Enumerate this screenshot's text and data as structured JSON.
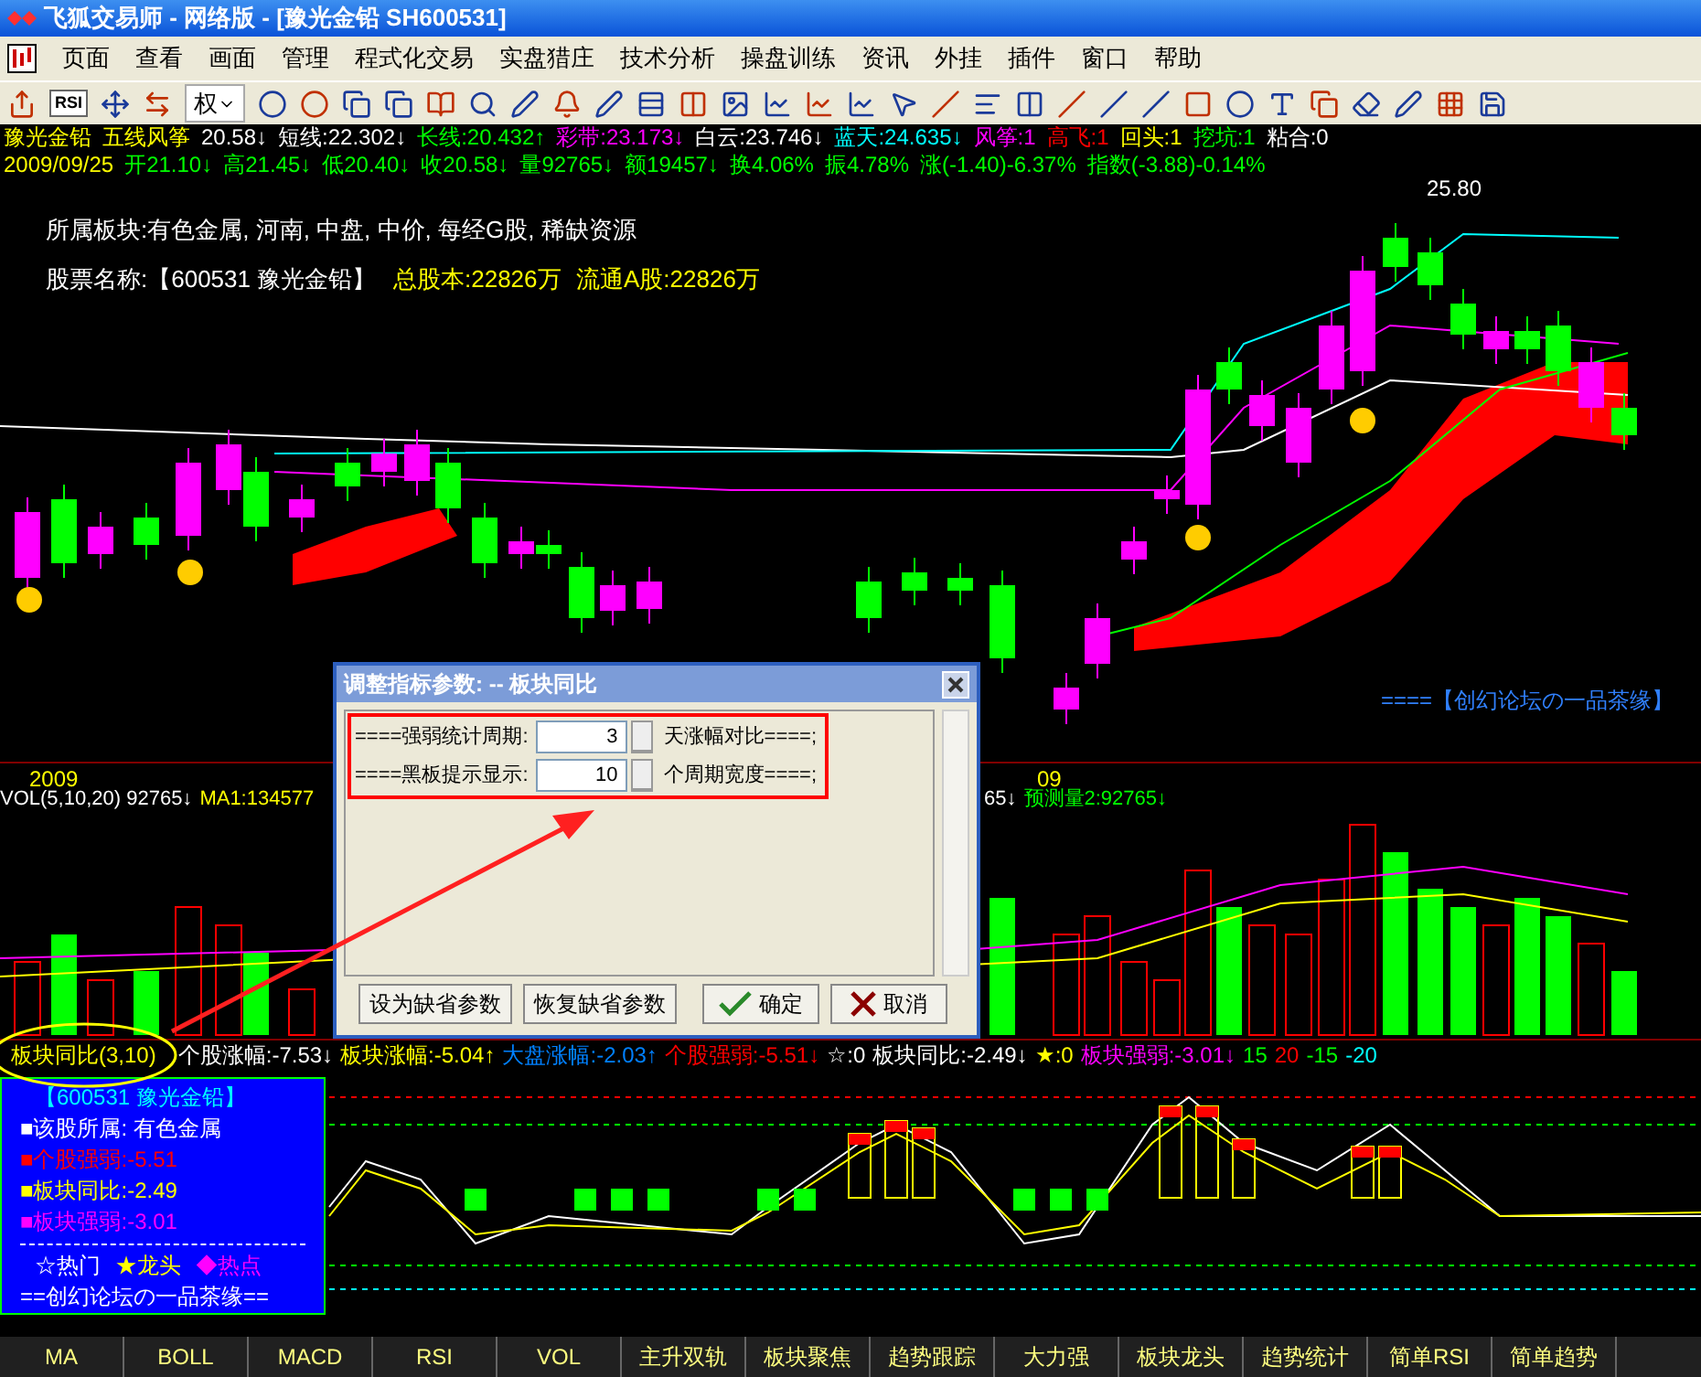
{
  "window": {
    "title": "飞狐交易师 - 网络版 - [豫光金铅 SH600531]"
  },
  "menu": [
    "页面",
    "查看",
    "画面",
    "管理",
    "程式化交易",
    "实盘猎庄",
    "技术分析",
    "操盘训练",
    "资讯",
    "外挂",
    "插件",
    "窗口",
    "帮助"
  ],
  "toolbar": {
    "rsi_label": "RSI",
    "rights_label": "权"
  },
  "quote_line": [
    {
      "text": "豫光金铅",
      "color": "#ffff00"
    },
    {
      "text": "五线风筝",
      "color": "#ffff00"
    },
    {
      "text": "20.58↓",
      "color": "#ffffff"
    },
    {
      "text": "短线:22.302↓",
      "color": "#ffffff"
    },
    {
      "text": "长线:20.432↑",
      "color": "#00ff00"
    },
    {
      "text": "彩带:23.173↓",
      "color": "#ff00ff"
    },
    {
      "text": "白云:23.746↓",
      "color": "#ffffff"
    },
    {
      "text": "蓝天:24.635↓",
      "color": "#00ffff"
    },
    {
      "text": "风筝:1",
      "color": "#ff00ff"
    },
    {
      "text": "高飞:1",
      "color": "#ff0000"
    },
    {
      "text": "回头:1",
      "color": "#ffff00"
    },
    {
      "text": "挖坑:1",
      "color": "#00ff00"
    },
    {
      "text": "粘合:0",
      "color": "#ffffff"
    }
  ],
  "price_line": [
    {
      "text": "2009/09/25",
      "color": "#ffff00"
    },
    {
      "text": "开21.10↓",
      "color": "#00ff00"
    },
    {
      "text": "高21.45↓",
      "color": "#00ff00"
    },
    {
      "text": "低20.40↓",
      "color": "#00ff00"
    },
    {
      "text": "收20.58↓",
      "color": "#00ff00"
    },
    {
      "text": "量92765↓",
      "color": "#00ff00"
    },
    {
      "text": "额19457↓",
      "color": "#00ff00"
    },
    {
      "text": "换4.06%",
      "color": "#00ff00"
    },
    {
      "text": "振4.78%",
      "color": "#00ff00"
    },
    {
      "text": "涨(-1.40)-6.37%",
      "color": "#00ff00"
    },
    {
      "text": "指数(-3.88)-0.14%",
      "color": "#00ff00"
    }
  ],
  "stock_info": {
    "sectors": "所属板块:有色金属, 河南, 中盘, 中价, 每经G股, 稀缺资源",
    "name": "股票名称:【600531 豫光金铅】",
    "total_shares": "总股本:22826万",
    "float_shares": "流通A股:22826万"
  },
  "price_chart": {
    "high_label": "25.80",
    "signature": "====【创幻论坛の一品茶缘】",
    "axis_labels": [
      "2009",
      "09"
    ]
  },
  "volume_line": [
    {
      "text": "VOL(5,10,20) 92765↓",
      "color": "#ffffff"
    },
    {
      "text": "MA1:134577",
      "color": "#ffff00"
    },
    {
      "text": "65↓",
      "color": "#ffffff"
    },
    {
      "text": "预测量2:92765↓",
      "color": "#00ff00"
    }
  ],
  "indicator_line": [
    {
      "text": "板块同比(3,10)",
      "color": "#ffff00"
    },
    {
      "text": "个股涨幅:-7.53↓",
      "color": "#ffffff"
    },
    {
      "text": "板块涨幅:-5.04↑",
      "color": "#ffff00"
    },
    {
      "text": "大盘涨幅:-2.03↑",
      "color": "#0080ff"
    },
    {
      "text": "个股强弱:-5.51↓",
      "color": "#ff0000"
    },
    {
      "text": "☆:0",
      "color": "#ffffff"
    },
    {
      "text": "板块同比:-2.49↓",
      "color": "#ffffff"
    },
    {
      "text": "★:0",
      "color": "#ffff00"
    },
    {
      "text": "板块强弱:-3.01↓",
      "color": "#ff00ff"
    },
    {
      "text": "15",
      "color": "#00ff00"
    },
    {
      "text": "20",
      "color": "#ff0000"
    },
    {
      "text": "-15",
      "color": "#00ff00"
    },
    {
      "text": "-20",
      "color": "#00ffff"
    }
  ],
  "info_box": {
    "title": "【600531 豫光金铅】",
    "items": [
      {
        "text": "■该股所属: 有色金属",
        "color": "#ffffff"
      },
      {
        "text": "■个股强弱:-5.51",
        "color": "#ff0000"
      },
      {
        "text": "■板块同比:-2.49",
        "color": "#ffff00"
      },
      {
        "text": "■板块强弱:-3.01",
        "color": "#ff00ff"
      }
    ],
    "legend": [
      {
        "text": "☆热门",
        "color": "#ffffff"
      },
      {
        "text": "★龙头",
        "color": "#ffff00"
      },
      {
        "text": "◆热点",
        "color": "#ff00ff"
      }
    ],
    "footer": "==创幻论坛の一品茶缘=="
  },
  "dialog": {
    "title": "调整指标参数: -- 板块同比",
    "params": [
      {
        "label": "====强弱统计周期:",
        "value": "3",
        "suffix": "天涨幅对比====;"
      },
      {
        "label": "====黑板提示显示:",
        "value": "10",
        "suffix": "个周期宽度====;"
      }
    ],
    "buttons": [
      {
        "label": "设为缺省参数",
        "kind": "plain"
      },
      {
        "label": "恢复缺省参数",
        "kind": "plain"
      },
      {
        "label": "确定",
        "kind": "ok"
      },
      {
        "label": "取消",
        "kind": "cancel"
      }
    ]
  },
  "bottom_tabs": [
    {
      "label": "MA",
      "selected": false
    },
    {
      "label": "BOLL",
      "selected": false
    },
    {
      "label": "MACD",
      "selected": false
    },
    {
      "label": "RSI",
      "selected": false
    },
    {
      "label": "VOL",
      "selected": false
    },
    {
      "label": "主升双轨",
      "selected": false
    },
    {
      "label": "板块聚焦",
      "selected": false
    },
    {
      "label": "趋势跟踪",
      "selected": false
    },
    {
      "label": "大力强",
      "selected": false
    },
    {
      "label": "板块龙头",
      "selected": false
    },
    {
      "label": "趋势统计",
      "selected": false
    },
    {
      "label": "简单RSI",
      "selected": false
    },
    {
      "label": "简单趋势",
      "selected": false
    }
  ]
}
